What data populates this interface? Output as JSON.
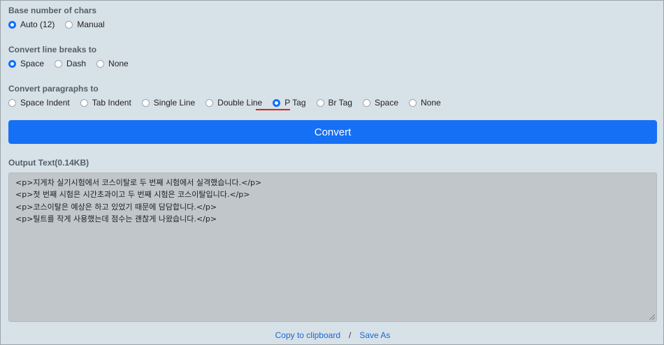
{
  "base_chars": {
    "label": "Base number of chars",
    "options": [
      {
        "label": "Auto (12)",
        "checked": true
      },
      {
        "label": "Manual",
        "checked": false
      }
    ]
  },
  "line_breaks": {
    "label": "Convert line breaks to",
    "options": [
      {
        "label": "Space",
        "checked": true
      },
      {
        "label": "Dash",
        "checked": false
      },
      {
        "label": "None",
        "checked": false
      }
    ]
  },
  "paragraphs": {
    "label": "Convert paragraphs to",
    "options": [
      {
        "label": "Space Indent",
        "checked": false
      },
      {
        "label": "Tab Indent",
        "checked": false
      },
      {
        "label": "Single Line",
        "checked": false
      },
      {
        "label": "Double Line",
        "checked": false
      },
      {
        "label": "P Tag",
        "checked": true
      },
      {
        "label": "Br Tag",
        "checked": false
      },
      {
        "label": "Space",
        "checked": false
      },
      {
        "label": "None",
        "checked": false
      }
    ]
  },
  "convert_button": "Convert",
  "output": {
    "label": "Output Text(0.14KB)",
    "lines": [
      "<p>지게차 실기시험에서 코스이탈로 두 번째 시험에서 실격했습니다.</p>",
      "<p>첫 번째 시험은 시간초과이고 두 번째 시험은 코스이탈입니다.</p>",
      "<p>코스이탈은 예상은 하고 있었기 때문에 담담합니다.</p>",
      "<p>틸트를 작게 사용했는데 점수는 괜찮게 나왔습니다.</p>"
    ]
  },
  "footer": {
    "copy_label": "Copy to clipboard",
    "separator": "/",
    "save_label": "Save As"
  },
  "colors": {
    "accent": "#0d6efd",
    "button": "#1670f5",
    "highlight_underline": "#e0201a",
    "background": "#d7e1e8"
  }
}
